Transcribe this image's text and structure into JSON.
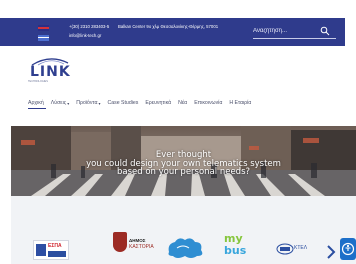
{
  "topbar": {
    "phone": "+(30) 2310 283403-5",
    "email": "info@link-tech.gr",
    "address": "Balkan Center 9ο χλμ Θεσσαλονίκης-Θέρμης, 57001",
    "search_placeholder": "Αναζήτηση...",
    "flags": [
      "english-flag",
      "greek-flag"
    ]
  },
  "logo": {
    "text": "LINK",
    "subtitle": "TECHNOLOGIES"
  },
  "nav": {
    "items": [
      {
        "label": "Αρχική",
        "dropdown": false
      },
      {
        "label": "Λύσεις",
        "dropdown": true
      },
      {
        "label": "Προϊόντα",
        "dropdown": true
      },
      {
        "label": "Case Studies",
        "dropdown": false
      },
      {
        "label": "Ερευνητικά",
        "dropdown": false
      },
      {
        "label": "Νέα",
        "dropdown": false
      },
      {
        "label": "Επικοινωνία",
        "dropdown": false
      },
      {
        "label": "Η Εταιρία",
        "dropdown": false
      }
    ],
    "active_index": 0
  },
  "hero": {
    "line1": "Ever thought",
    "line2": "you could design your own telematics system",
    "line3": "based on your personal needs?"
  },
  "partners": {
    "espa_title": "ΕΣΠΑ",
    "kastoria_line1": "ΔΗΜΟΣ",
    "kastoria_line2": "ΚΑΣΤΟΡΙΑ",
    "mybus_line1": "my",
    "mybus_line2": "bus",
    "ktel_text": "ΚΤΕΛ"
  },
  "colors": {
    "topbar": "#2f3b8c",
    "accent": "#2f3b8c",
    "nav_text": "#4a4f6a"
  }
}
